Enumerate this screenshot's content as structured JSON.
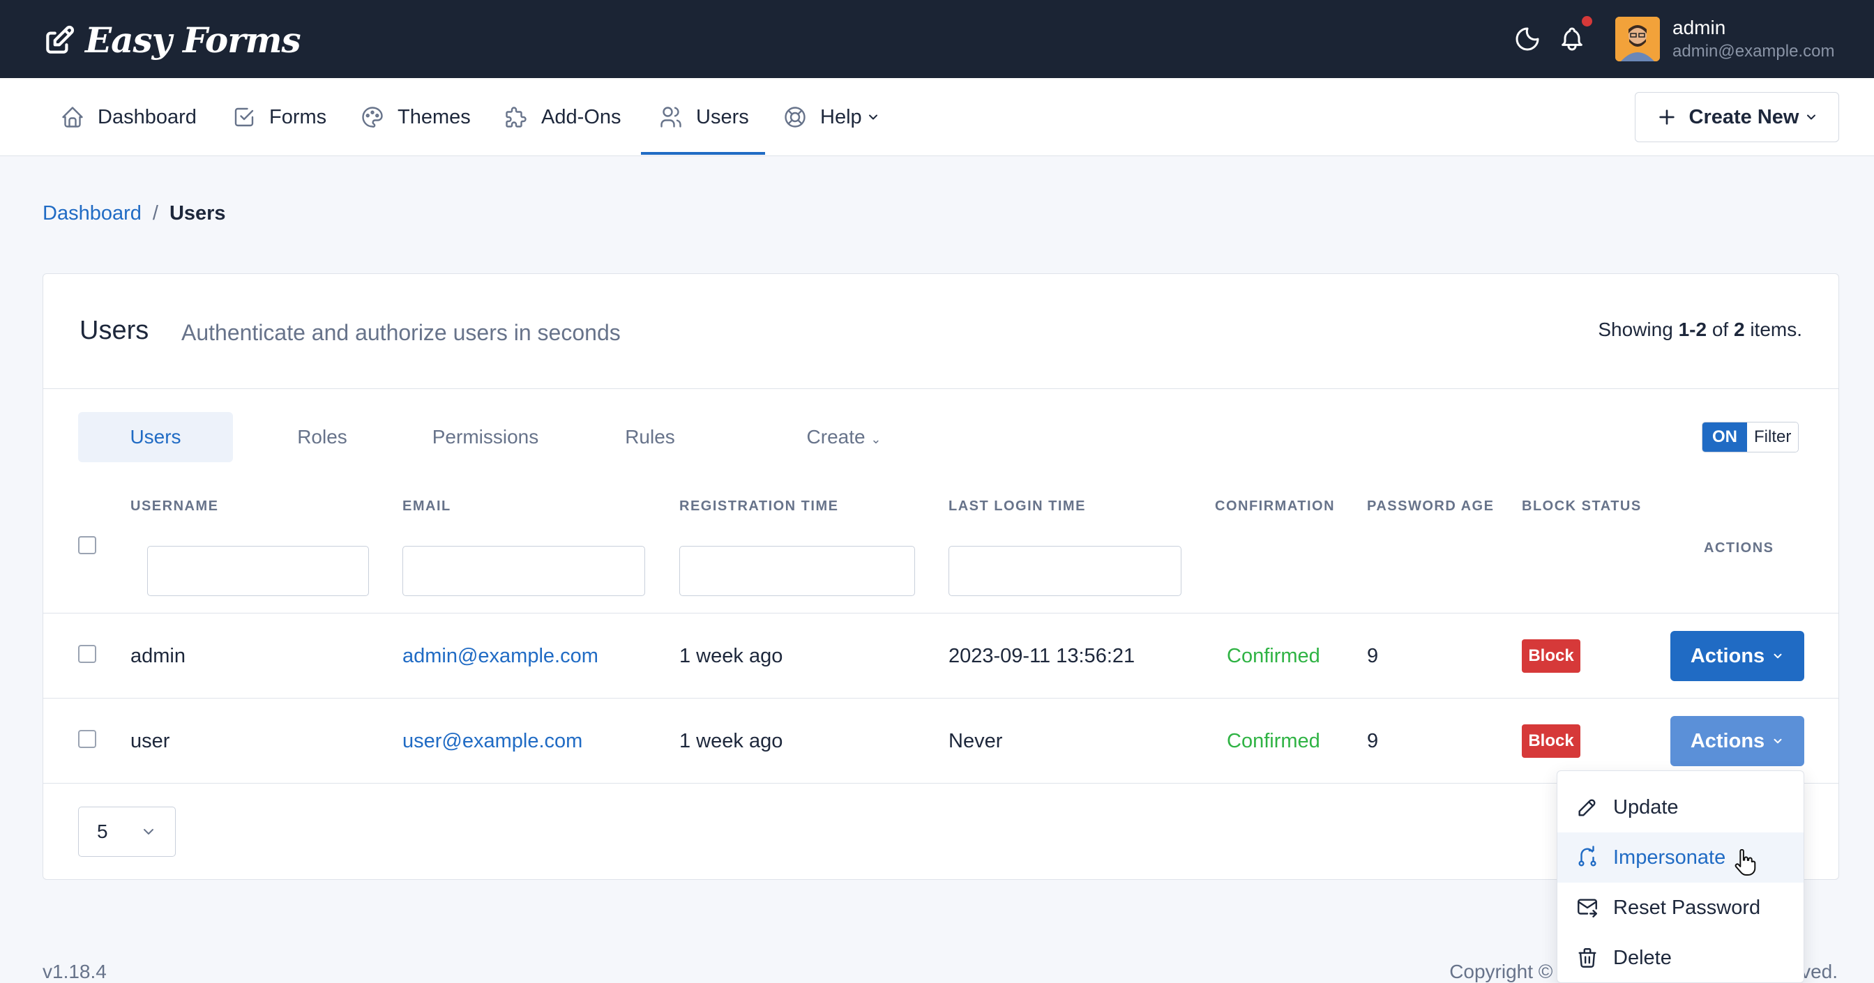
{
  "app": {
    "brand": "Easy Forms",
    "user_name": "admin",
    "user_email": "admin@example.com"
  },
  "nav": {
    "items": [
      {
        "label": "Dashboard",
        "icon": "home-icon"
      },
      {
        "label": "Forms",
        "icon": "checkbox-icon"
      },
      {
        "label": "Themes",
        "icon": "palette-icon"
      },
      {
        "label": "Add-Ons",
        "icon": "puzzle-icon"
      },
      {
        "label": "Users",
        "icon": "users-icon",
        "active": true
      },
      {
        "label": "Help",
        "icon": "lifebuoy-icon"
      }
    ],
    "create_new": "Create New"
  },
  "breadcrumb": {
    "home": "Dashboard",
    "separator": "/",
    "current": "Users"
  },
  "card": {
    "title": "Users",
    "subtitle": "Authenticate and authorize users in seconds",
    "showing_prefix": "Showing",
    "showing_range": "1-2",
    "showing_of": "of",
    "showing_total": "2",
    "showing_suffix": "items."
  },
  "tabs": [
    {
      "label": "Users",
      "active": true
    },
    {
      "label": "Roles"
    },
    {
      "label": "Permissions"
    },
    {
      "label": "Rules"
    },
    {
      "label": "Create"
    }
  ],
  "filter_toggle": {
    "on_label": "ON",
    "label": "Filter"
  },
  "table": {
    "columns": [
      "USERNAME",
      "EMAIL",
      "REGISTRATION TIME",
      "LAST LOGIN TIME",
      "CONFIRMATION",
      "PASSWORD AGE",
      "BLOCK STATUS",
      "ACTIONS"
    ],
    "rows": [
      {
        "username": "admin",
        "email": "admin@example.com",
        "registration": "1 week ago",
        "last_login": "2023-09-11 13:56:21",
        "confirmation": "Confirmed",
        "password_age": "9",
        "block": "Block",
        "actions": "Actions"
      },
      {
        "username": "user",
        "email": "user@example.com",
        "registration": "1 week ago",
        "last_login": "Never",
        "confirmation": "Confirmed",
        "password_age": "9",
        "block": "Block",
        "actions": "Actions"
      }
    ]
  },
  "page_size": "5",
  "footer": {
    "version": "v1.18.4",
    "copyright": "Copyright © 2023",
    "copyright_end": "ved."
  },
  "dropdown": {
    "items": [
      {
        "label": "Update",
        "icon": "pencil-icon"
      },
      {
        "label": "Impersonate",
        "icon": "impersonate-icon",
        "hover": true
      },
      {
        "label": "Reset Password",
        "icon": "mail-forward-icon"
      },
      {
        "label": "Delete",
        "icon": "trash-icon"
      }
    ]
  },
  "colors": {
    "topbar": "#1b2434",
    "primary": "#206bc4",
    "success": "#2fb344",
    "danger": "#d63939",
    "muted": "#67738a"
  }
}
